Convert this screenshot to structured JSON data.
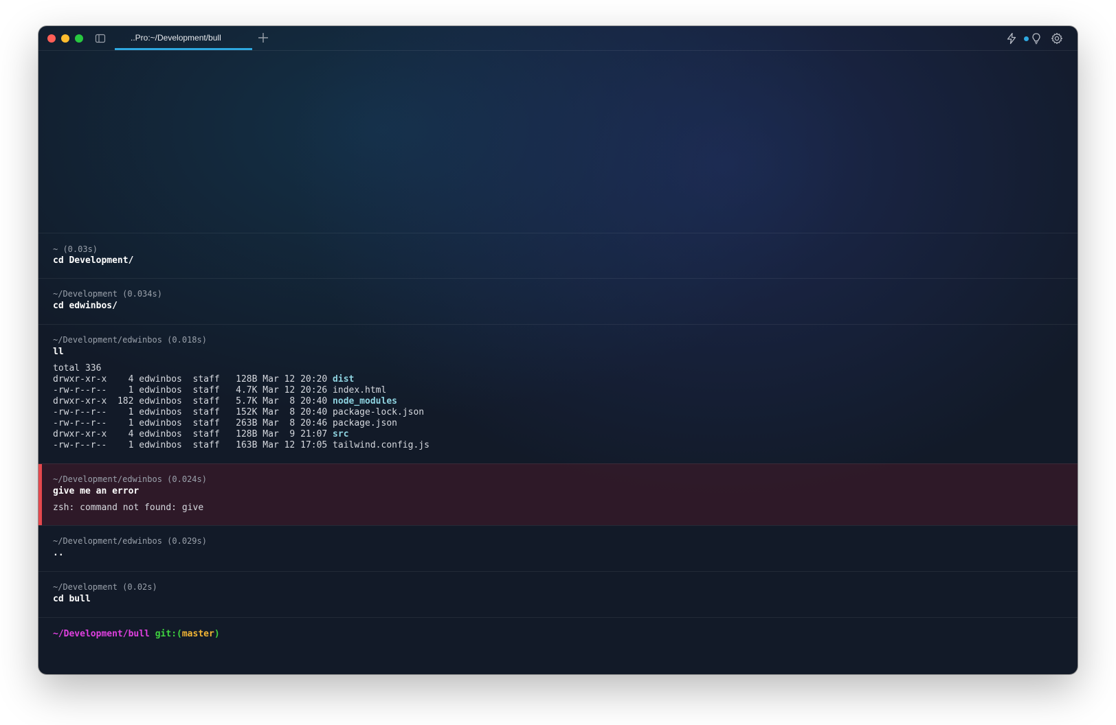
{
  "window": {
    "tab_title": "..Pro:~/Development/bull"
  },
  "icons": {
    "sidebar": "sidebar-toggle-icon",
    "new_tab": "plus-icon",
    "warp_ai": "lightning-bolt-icon",
    "tips": "lightbulb-icon",
    "settings": "gear-icon"
  },
  "colors": {
    "accent": "#2ea8e0",
    "error": "#e5484d",
    "dir": "#8ed3e0",
    "prompt_path": "#e040e0",
    "prompt_git": "#3fd33f",
    "prompt_branch": "#f2b534"
  },
  "blocks": [
    {
      "meta": "~ (0.03s)",
      "command": "cd Development/"
    },
    {
      "meta": "~/Development (0.034s)",
      "command": "cd edwinbos/"
    },
    {
      "meta": "~/Development/edwinbos (0.018s)",
      "command": "ll",
      "output_total": "total 336",
      "listing": [
        {
          "perm": "drwxr-xr-x",
          "links": "4",
          "owner": "edwinbos",
          "group": "staff",
          "size": "128B",
          "date": "Mar 12 20:20",
          "name": "dist",
          "is_dir": true
        },
        {
          "perm": "-rw-r--r--",
          "links": "1",
          "owner": "edwinbos",
          "group": "staff",
          "size": "4.7K",
          "date": "Mar 12 20:26",
          "name": "index.html",
          "is_dir": false
        },
        {
          "perm": "drwxr-xr-x",
          "links": "182",
          "owner": "edwinbos",
          "group": "staff",
          "size": "5.7K",
          "date": "Mar  8 20:40",
          "name": "node_modules",
          "is_dir": true
        },
        {
          "perm": "-rw-r--r--",
          "links": "1",
          "owner": "edwinbos",
          "group": "staff",
          "size": "152K",
          "date": "Mar  8 20:40",
          "name": "package-lock.json",
          "is_dir": false
        },
        {
          "perm": "-rw-r--r--",
          "links": "1",
          "owner": "edwinbos",
          "group": "staff",
          "size": "263B",
          "date": "Mar  8 20:46",
          "name": "package.json",
          "is_dir": false
        },
        {
          "perm": "drwxr-xr-x",
          "links": "4",
          "owner": "edwinbos",
          "group": "staff",
          "size": "128B",
          "date": "Mar  9 21:07",
          "name": "src",
          "is_dir": true
        },
        {
          "perm": "-rw-r--r--",
          "links": "1",
          "owner": "edwinbos",
          "group": "staff",
          "size": "163B",
          "date": "Mar 12 17:05",
          "name": "tailwind.config.js",
          "is_dir": false
        }
      ]
    },
    {
      "meta": "~/Development/edwinbos (0.024s)",
      "command": "give me an error",
      "output": "zsh: command not found: give",
      "error": true
    },
    {
      "meta": "~/Development/edwinbos (0.029s)",
      "command": ".."
    },
    {
      "meta": "~/Development (0.02s)",
      "command": "cd bull"
    }
  ],
  "prompt": {
    "path": "~/Development/bull",
    "git_prefix": "git:(",
    "branch": "master",
    "git_suffix": ")"
  }
}
